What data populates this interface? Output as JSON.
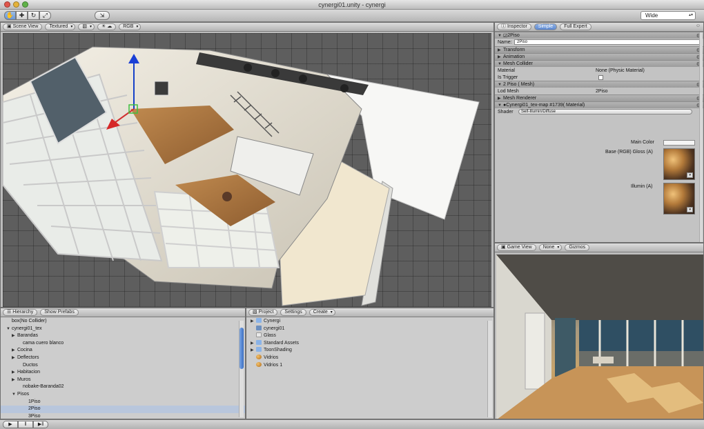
{
  "window": {
    "title": "cynergi01.unity - cynergi"
  },
  "toolbar": {
    "tools": [
      {
        "name": "hand",
        "glyph": "✋"
      },
      {
        "name": "move",
        "glyph": "✚"
      },
      {
        "name": "rotate",
        "glyph": "↻"
      },
      {
        "name": "scale",
        "glyph": "⤢"
      }
    ],
    "layout": "Wide"
  },
  "scene_view": {
    "tab_label": "Scene View",
    "render_mode": "Textured",
    "light_mode": "RGB"
  },
  "inspector": {
    "tab_label": "Inspector",
    "mode_simple": "Simple",
    "mode_full": "Full Expert",
    "object_name": "2Piso",
    "name_label": "Name:",
    "components": [
      {
        "label": "Transform"
      },
      {
        "label": "Animation"
      },
      {
        "label": "Mesh Collider"
      }
    ],
    "mesh_collider": {
      "material_label": "Material",
      "material_value": "None (Physic Material)",
      "is_trigger_label": "Is Trigger"
    },
    "mesh_filter": {
      "header": "2 Piso ( Mesh)",
      "lod_label": "Lod Mesh",
      "lod_value": "2Piso"
    },
    "mesh_renderer": {
      "header": "Mesh Renderer"
    },
    "material": {
      "header": "Cynergi01_tex-map #1739( Material)",
      "shader_label": "Shader",
      "shader_value": "Self-Illumin/Diffuse",
      "main_color_label": "Main Color",
      "base_label": "Base (RGB) Gloss (A)",
      "illumin_label": "Illumin (A)"
    }
  },
  "game_view": {
    "tab_label": "Game View",
    "aspect": "None",
    "gizmos_label": "Gizmos"
  },
  "hierarchy": {
    "tab_label": "Hierarchy",
    "show_prefabs_label": "Show Prefabs",
    "items": [
      {
        "label": "box(No Collider)",
        "indent": 1,
        "arrow": "",
        "selected": false
      },
      {
        "label": "cynergi01_tex",
        "indent": 1,
        "arrow": "▼",
        "selected": false
      },
      {
        "label": "Barandas",
        "indent": 2,
        "arrow": "▶",
        "selected": false
      },
      {
        "label": "cama cuero blanco",
        "indent": 3,
        "arrow": "",
        "selected": false
      },
      {
        "label": "Cocina",
        "indent": 2,
        "arrow": "▶",
        "selected": false
      },
      {
        "label": "Deflectors",
        "indent": 2,
        "arrow": "▶",
        "selected": false
      },
      {
        "label": "Ductos",
        "indent": 3,
        "arrow": "",
        "selected": false
      },
      {
        "label": "Habitacion",
        "indent": 2,
        "arrow": "▶",
        "selected": false
      },
      {
        "label": "Muros",
        "indent": 2,
        "arrow": "▶",
        "selected": false
      },
      {
        "label": "nobake-Baranda02",
        "indent": 3,
        "arrow": "",
        "selected": false
      },
      {
        "label": "Pisos",
        "indent": 2,
        "arrow": "▼",
        "selected": false
      },
      {
        "label": "1Piso",
        "indent": 4,
        "arrow": "",
        "selected": false
      },
      {
        "label": "2Piso",
        "indent": 4,
        "arrow": "",
        "selected": true
      },
      {
        "label": "3Piso",
        "indent": 4,
        "arrow": "",
        "selected": false
      }
    ]
  },
  "project": {
    "tab_label": "Project",
    "settings_label": "Settings",
    "create_label": "Create",
    "items": [
      {
        "label": "Cynergi",
        "arrow": "▶",
        "icon": "folder"
      },
      {
        "label": "cynergi01",
        "arrow": "",
        "icon": "prefab"
      },
      {
        "label": "Glass",
        "arrow": "",
        "icon": "file"
      },
      {
        "label": "Standard Assets",
        "arrow": "▶",
        "icon": "folder"
      },
      {
        "label": "ToonShading",
        "arrow": "▶",
        "icon": "folder"
      },
      {
        "label": "Vidrios",
        "arrow": "",
        "icon": "mat"
      },
      {
        "label": "Vidrios 1",
        "arrow": "",
        "icon": "mat"
      }
    ]
  },
  "statusbar": {
    "play": "▶",
    "pause": "‖",
    "step": "▶‖"
  }
}
